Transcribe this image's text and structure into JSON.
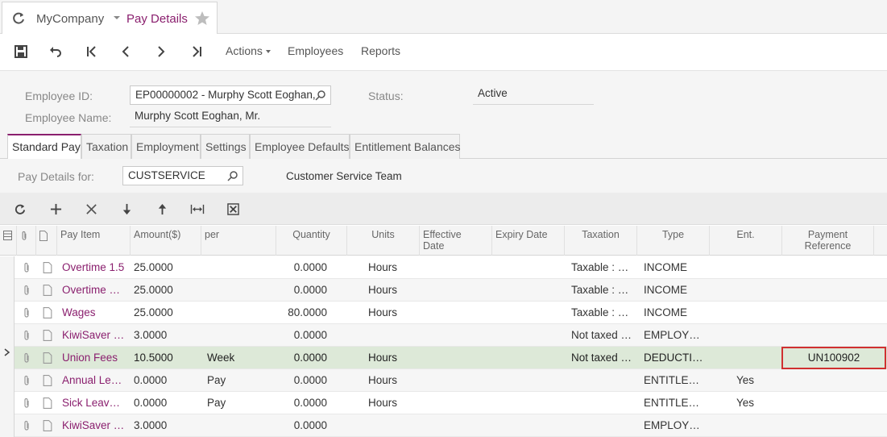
{
  "title": {
    "company": "MyCompany",
    "screen": "Pay Details"
  },
  "toolbar": {
    "actions": "Actions",
    "employees": "Employees",
    "reports": "Reports"
  },
  "form": {
    "employee_id_label": "Employee ID:",
    "employee_id_value": "EP00000002 - Murphy Scott Eoghan,",
    "employee_name_label": "Employee Name:",
    "employee_name_value": "Murphy Scott Eoghan, Mr.",
    "status_label": "Status:",
    "status_value": "Active"
  },
  "tabs": [
    "Standard Pay",
    "Taxation",
    "Employment",
    "Settings",
    "Employee Defaults",
    "Entitlement Balances"
  ],
  "paydetails": {
    "label": "Pay Details for:",
    "value": "CUSTSERVICE",
    "description": "Customer Service Team"
  },
  "columns": {
    "pay_item": "Pay Item",
    "amount": "Amount($)",
    "per": "per",
    "quantity": "Quantity",
    "units": "Units",
    "effective_date_1": "Effective",
    "effective_date_2": "Date",
    "expiry_date": "Expiry Date",
    "taxation": "Taxation",
    "type": "Type",
    "ent": "Ent.",
    "payref_1": "Payment",
    "payref_2": "Reference"
  },
  "rows": [
    {
      "pay_item": "Overtime 1.5",
      "amount": "25.0000",
      "per": "",
      "quantity": "0.0000",
      "units": "Hours",
      "taxation": "Taxable : …",
      "type": "INCOME",
      "ent": "",
      "payref": ""
    },
    {
      "pay_item": "Overtime …",
      "amount": "25.0000",
      "per": "",
      "quantity": "0.0000",
      "units": "Hours",
      "taxation": "Taxable : …",
      "type": "INCOME",
      "ent": "",
      "payref": ""
    },
    {
      "pay_item": "Wages",
      "amount": "25.0000",
      "per": "",
      "quantity": "80.0000",
      "units": "Hours",
      "taxation": "Taxable : …",
      "type": "INCOME",
      "ent": "",
      "payref": ""
    },
    {
      "pay_item": "KiwiSaver …",
      "amount": "3.0000",
      "per": "",
      "quantity": "0.0000",
      "units": "",
      "taxation": "Not taxed …",
      "type": "EMPLOY…",
      "ent": "",
      "payref": ""
    },
    {
      "pay_item": "Union Fees",
      "amount": "10.5000",
      "per": "Week",
      "quantity": "0.0000",
      "units": "Hours",
      "taxation": "Not taxed …",
      "type": "DEDUCTI…",
      "ent": "",
      "payref": "UN100902"
    },
    {
      "pay_item": "Annual Le…",
      "amount": "0.0000",
      "per": "Pay",
      "quantity": "0.0000",
      "units": "Hours",
      "taxation": "",
      "type": "ENTITLE…",
      "ent": "Yes",
      "payref": ""
    },
    {
      "pay_item": "Sick Leav…",
      "amount": "0.0000",
      "per": "Pay",
      "quantity": "0.0000",
      "units": "Hours",
      "taxation": "",
      "type": "ENTITLE…",
      "ent": "Yes",
      "payref": ""
    },
    {
      "pay_item": "KiwiSaver …",
      "amount": "3.0000",
      "per": "",
      "quantity": "0.0000",
      "units": "",
      "taxation": "",
      "type": "EMPLOY…",
      "ent": "",
      "payref": ""
    }
  ],
  "selected_row_index": 4,
  "colors": {
    "accent": "#8a1f6e",
    "selected_row": "#dde9d8",
    "highlight_border": "#d03030"
  }
}
